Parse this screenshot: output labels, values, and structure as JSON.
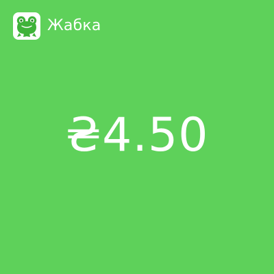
{
  "header": {
    "app_name": "Жабка",
    "logo_icon": "frog-logo-icon"
  },
  "payment": {
    "amount_display": "₴4.50"
  },
  "colors": {
    "background": "#5ed15a",
    "text": "#ffffff",
    "logo_green": "#3fb33a"
  }
}
